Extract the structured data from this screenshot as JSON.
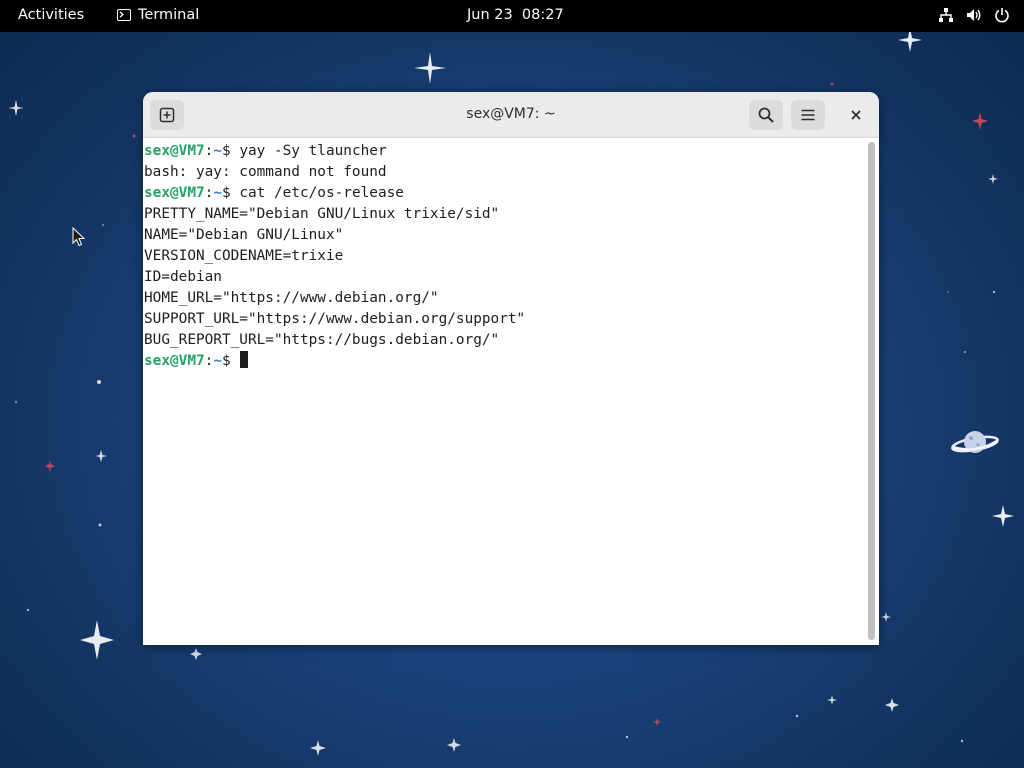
{
  "top_bar": {
    "activities_label": "Activities",
    "app_name": "Terminal",
    "clock": "Jun 23  08:27",
    "icons": [
      "network-icon",
      "volume-icon",
      "power-icon"
    ]
  },
  "window": {
    "title": "sex@VM7: ~",
    "buttons": [
      "new-tab-icon",
      "search-icon",
      "hamburger-menu-icon",
      "close-icon"
    ]
  },
  "terminal": {
    "prompt_user": "sex@VM7",
    "prompt_sep": ":",
    "prompt_path": "~",
    "prompt_suffix": "$ ",
    "lines": [
      {
        "type": "command",
        "text": "yay -Sy tlauncher"
      },
      {
        "type": "output",
        "text": "bash: yay: command not found"
      },
      {
        "type": "command",
        "text": "cat /etc/os-release"
      },
      {
        "type": "output",
        "text": "PRETTY_NAME=\"Debian GNU/Linux trixie/sid\""
      },
      {
        "type": "output",
        "text": "NAME=\"Debian GNU/Linux\""
      },
      {
        "type": "output",
        "text": "VERSION_CODENAME=trixie"
      },
      {
        "type": "output",
        "text": "ID=debian"
      },
      {
        "type": "output",
        "text": "HOME_URL=\"https://www.debian.org/\""
      },
      {
        "type": "output",
        "text": "SUPPORT_URL=\"https://www.debian.org/support\""
      },
      {
        "type": "output",
        "text": "BUG_REPORT_URL=\"https://bugs.debian.org/\""
      },
      {
        "type": "command",
        "text": "",
        "cursor": true
      }
    ]
  },
  "colors": {
    "prompt_user": "#26a269",
    "prompt_path": "#2a7bde",
    "topbar": "#000000",
    "headerbar": "#ebebeb"
  }
}
